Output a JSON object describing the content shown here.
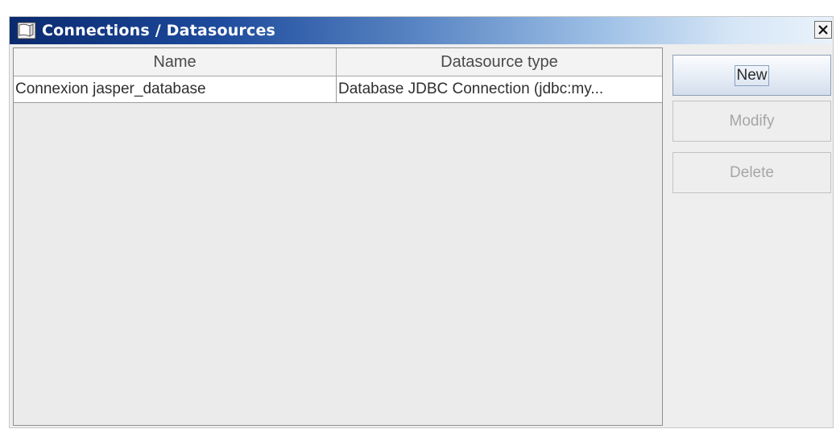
{
  "window": {
    "title": "Connections / Datasources",
    "title_icon": "document-icon",
    "close_icon": "close-icon"
  },
  "table": {
    "columns": [
      "Name",
      "Datasource type"
    ],
    "rows": [
      {
        "name": "Connexion jasper_database",
        "type": "Database JDBC Connection (jdbc:my..."
      }
    ]
  },
  "buttons": {
    "new_label": "New",
    "modify_label": "Modify",
    "delete_label": "Delete"
  },
  "colors": {
    "titlebar_start": "#0a2a6e",
    "titlebar_end": "#e9f2fb",
    "disabled_text": "#a6a6a6"
  }
}
